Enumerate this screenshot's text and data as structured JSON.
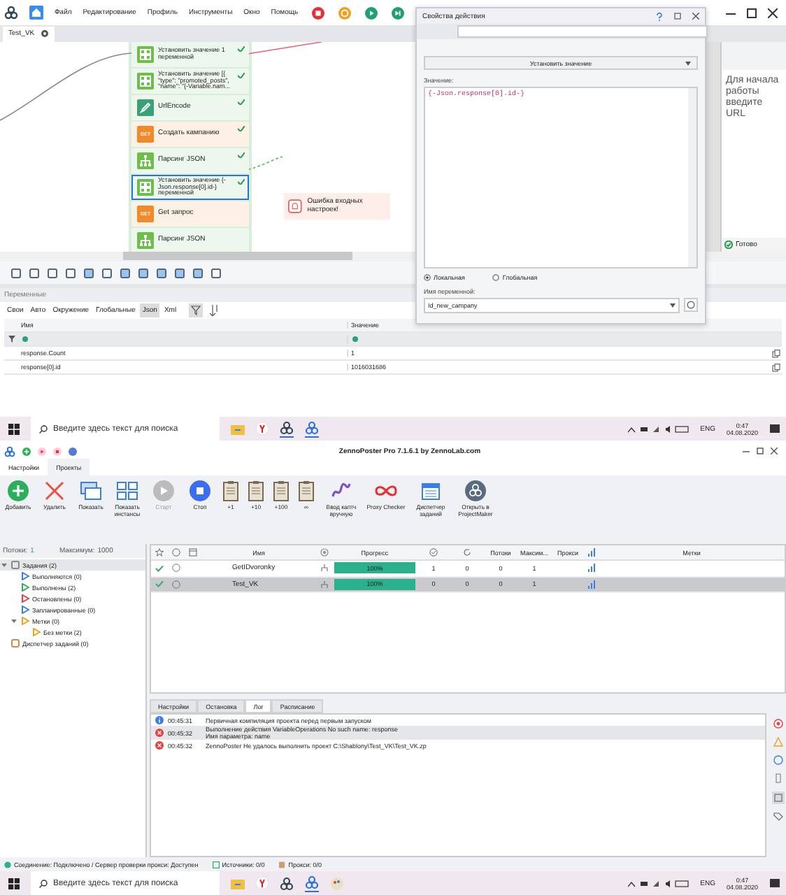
{
  "editor": {
    "menu": [
      "Файл",
      "Редактирование",
      "Профиль",
      "Инструменты",
      "Окно",
      "Помощь"
    ],
    "tab": "Test_VK",
    "nodes": [
      {
        "kind": "set",
        "label": "Установить значение 1 переменной",
        "done": true,
        "selected": false
      },
      {
        "kind": "set",
        "label": "Установить значение [{ \"type\": \"promoted_posts\", \"name\": \"{-Variable.nam...",
        "done": true,
        "selected": false
      },
      {
        "kind": "encode",
        "label": "UrlEncode",
        "done": true,
        "selected": false
      },
      {
        "kind": "get",
        "badge": "GET",
        "label": "Создать кампанию",
        "done": true,
        "selected": false
      },
      {
        "kind": "json",
        "label": "Парсинг JSON",
        "done": true,
        "selected": false
      },
      {
        "kind": "set",
        "label": "Установить значение {-Json.response[0].id-} переменной",
        "done": true,
        "selected": true
      },
      {
        "kind": "get",
        "badge": "GET",
        "label": "Get запрос",
        "done": false,
        "selected": false
      },
      {
        "kind": "json",
        "label": "Парсинг JSON",
        "done": false,
        "selected": false
      }
    ],
    "error_node": "Ошибка входных настроек!",
    "browser_hint": "Для начала работы введите URL",
    "browser_status": "Готово"
  },
  "dialog": {
    "title": "Свойства действия",
    "action": "Установить значение",
    "value_label": "Значение:",
    "value": "{-Json.response[0].id-}",
    "scope": [
      {
        "label": "Локальная",
        "selected": true
      },
      {
        "label": "Глобальная",
        "selected": false
      }
    ],
    "varname_label": "Имя переменной:",
    "varname": "Id_new_campany"
  },
  "variables": {
    "title": "Переменные",
    "tabs": [
      {
        "label": "Свои",
        "selected": false
      },
      {
        "label": "Авто",
        "selected": false
      },
      {
        "label": "Окружение",
        "selected": false
      },
      {
        "label": "Глобальные",
        "selected": false
      },
      {
        "label": "Json",
        "selected": true
      },
      {
        "label": "Xml",
        "selected": false
      }
    ],
    "columns": [
      "Имя",
      "Значение"
    ],
    "rows": [
      {
        "name": "response.Count",
        "value": "1"
      },
      {
        "name": "response[0].id",
        "value": "1016031686"
      }
    ]
  },
  "taskbars": [
    {
      "search": {
        "placeholder": "Введите здесь текст для поиска"
      },
      "lang": "ENG",
      "time": "0:47",
      "date": "04.08.2020"
    },
    {
      "search": {
        "placeholder": "Введите здесь текст для поиска"
      },
      "lang": "ENG",
      "time": "0:47",
      "date": "04.08.2020"
    }
  ],
  "zp": {
    "title": "ZennoPoster Pro 7.1.6.1 by ZennoLab.com",
    "ribbon_tabs": [
      {
        "label": "Настройки",
        "selected": false
      },
      {
        "label": "Проекты",
        "selected": true
      }
    ],
    "toolbar": [
      {
        "kind": "add",
        "label": "Добавить",
        "disabled": false
      },
      {
        "kind": "delete",
        "label": "Удалить",
        "disabled": false
      },
      {
        "kind": "show",
        "label": "Показать",
        "disabled": false
      },
      {
        "kind": "instances",
        "label": "Показать инстансы",
        "disabled": false
      },
      {
        "kind": "start",
        "label": "Старт",
        "disabled": true
      },
      {
        "kind": "stop",
        "label": "Стоп",
        "disabled": false
      },
      {
        "kind": "clip",
        "label": "+1",
        "disabled": false
      },
      {
        "kind": "clip",
        "label": "+10",
        "disabled": false
      },
      {
        "kind": "clip",
        "label": "+100",
        "disabled": false
      },
      {
        "kind": "clip",
        "label": "∞",
        "disabled": false
      },
      {
        "kind": "captcha",
        "label": "Ввод каптч вручную",
        "disabled": false
      },
      {
        "kind": "proxy",
        "label": "Proxy Checker",
        "disabled": false
      },
      {
        "kind": "scheduler",
        "label": "Диспетчер заданий",
        "disabled": false
      },
      {
        "kind": "open",
        "label": "Открыть в ProjectMaker",
        "disabled": false
      }
    ],
    "threads_label": "Потоки:",
    "threads": "1",
    "max_label": "Максимум:",
    "max": "1000",
    "tree": [
      {
        "kind": "tasks",
        "label": "Задания (2)",
        "expanded": true,
        "selected": true,
        "children": [
          {
            "kind": "running",
            "label": "Выполняются (0)",
            "selected": false
          },
          {
            "kind": "done",
            "label": "Выполнены (2)",
            "selected": false
          },
          {
            "kind": "stopped",
            "label": "Остановлены (0)",
            "selected": false
          },
          {
            "kind": "scheduled",
            "label": "Запланированные (0)",
            "selected": false
          },
          {
            "kind": "labels",
            "label": "Метки (0)",
            "expanded": true,
            "selected": false,
            "children": [
              {
                "kind": "labels",
                "label": "Без метки (2)",
                "selected": false
              }
            ]
          }
        ]
      },
      {
        "kind": "scheduler",
        "label": "Диспетчер заданий (0)",
        "selected": false
      }
    ],
    "columns": [
      "Имя",
      "Прогресс",
      "Потоки",
      "Максим...",
      "Прокси",
      "Метки"
    ],
    "rows": [
      {
        "done": true,
        "name": "GetIDvoronky",
        "progress": "100%",
        "level": 1,
        "values": [
          "1",
          "0",
          "0",
          "1"
        ],
        "selected": false
      },
      {
        "done": true,
        "name": "Test_VK",
        "progress": "100%",
        "level": 1,
        "values": [
          "0",
          "0",
          "0",
          "1"
        ],
        "selected": true
      }
    ],
    "bottom_tabs": [
      {
        "label": "Настройки",
        "selected": false
      },
      {
        "label": "Остановка",
        "selected": false
      },
      {
        "label": "Лог",
        "selected": true
      },
      {
        "label": "Расписание",
        "selected": false
      }
    ],
    "log": [
      {
        "kind": "info",
        "time": "00:45:31",
        "lines": [
          "Первичная компиляция проекта перед первым запуском"
        ],
        "selected": false
      },
      {
        "kind": "error",
        "time": "00:45:32",
        "lines": [
          "Выполнение действия VariableOperations No such name: response",
          "Имя параметра: name"
        ],
        "selected": true
      },
      {
        "kind": "error",
        "time": "00:45:32",
        "lines": [
          "ZennoPoster Не удалось выполнить проект C:\\Shablony\\Test_VK\\Test_VK.zp"
        ],
        "selected": false
      }
    ],
    "status": [
      {
        "kind": "connection",
        "label": "Соединение: Подключено / Сервер проверки прокси: Доступен"
      },
      {
        "kind": "sources",
        "label": "Источники: 0/0"
      },
      {
        "kind": "proxy",
        "label": "Прокси: 0/0"
      }
    ]
  }
}
